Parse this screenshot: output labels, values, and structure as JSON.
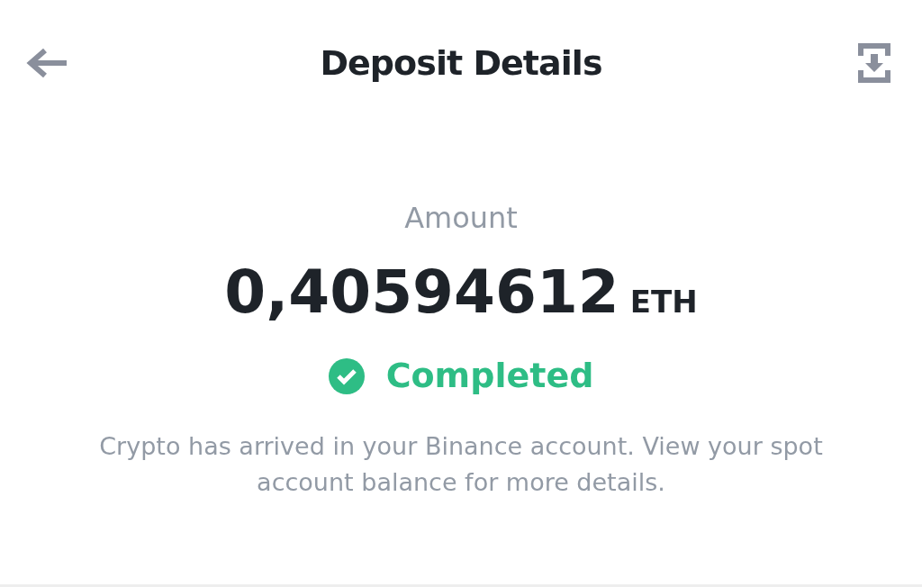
{
  "header": {
    "title": "Deposit Details"
  },
  "amount": {
    "label": "Amount",
    "value": "0,40594612",
    "unit": "ETH"
  },
  "status": {
    "kind": "completed",
    "label": "Completed"
  },
  "message": "Crypto has arrived in your Binance account. View your spot account balance for more details."
}
